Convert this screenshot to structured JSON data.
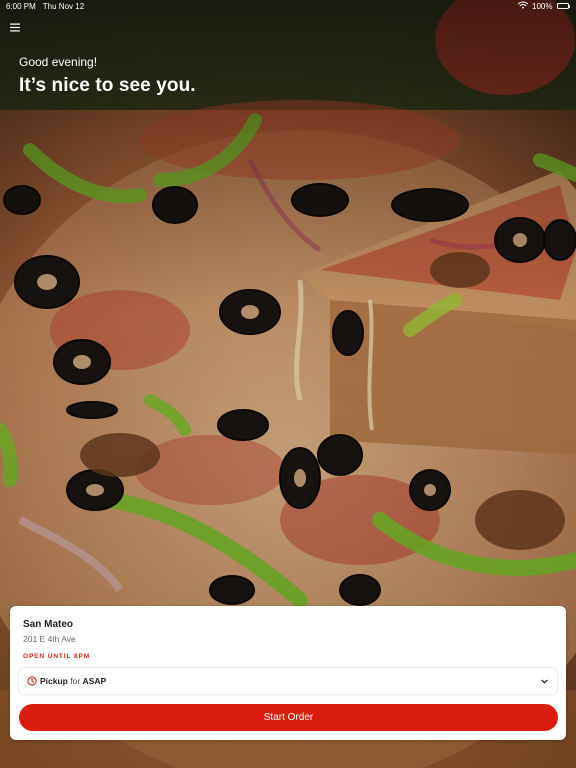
{
  "status_bar": {
    "time": "6:00 PM",
    "date": "Thu Nov 12",
    "battery": "100%",
    "icons": [
      "wifi-icon",
      "battery-icon"
    ]
  },
  "header": {
    "menu_icon": "hamburger-menu-icon"
  },
  "greeting": {
    "small": "Good evening!",
    "large": "It’s nice to see you."
  },
  "hero": {
    "image": "pizza-photo"
  },
  "order_card": {
    "store_name": "San Mateo",
    "store_address": "201 E 4th Ave",
    "hours_label": "OPEN UNTIL 8PM",
    "method": {
      "mode": "Pickup",
      "connector": "for",
      "time": "ASAP",
      "icon": "clock-icon",
      "dropdown_icon": "chevron-down-icon"
    },
    "start_button": "Start Order"
  },
  "colors": {
    "accent": "#d91e0f",
    "hours_text": "#d7261b",
    "card_bg": "#ffffff"
  }
}
